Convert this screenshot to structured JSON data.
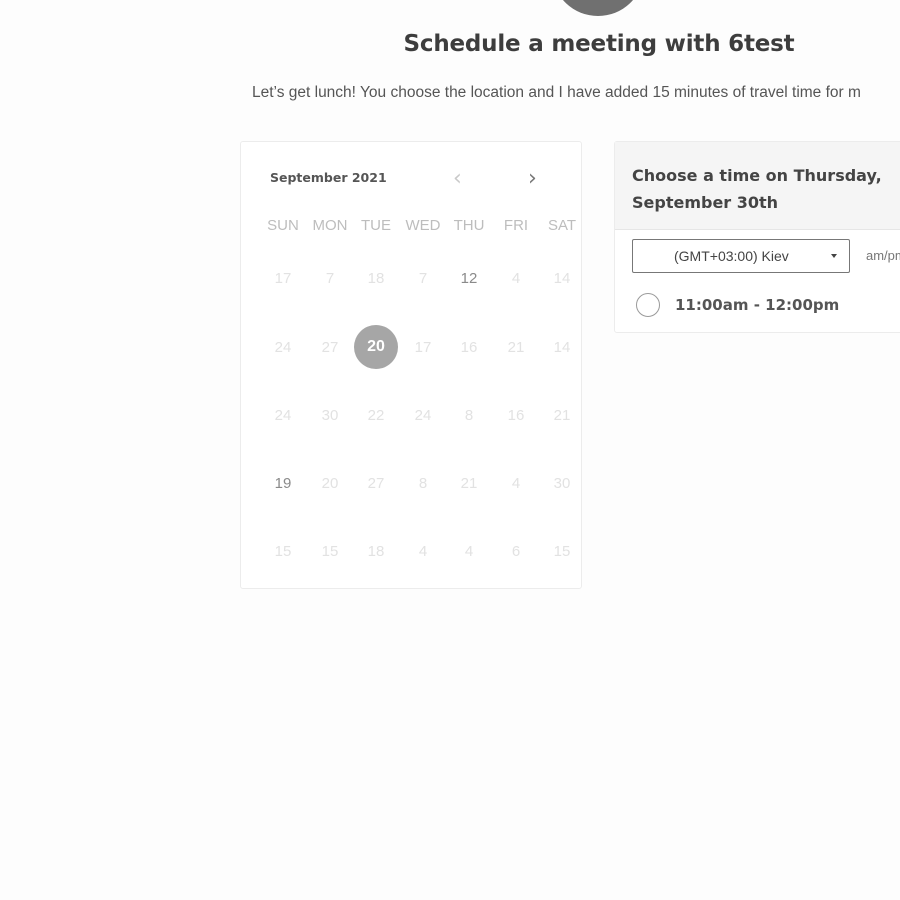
{
  "page": {
    "title": "Schedule a meeting with 6test",
    "description": "Let’s get lunch! You choose the location and I have added 15 minutes of travel time for m"
  },
  "calendar": {
    "month_label": "September 2021",
    "prev_symbol": "‹",
    "next_symbol": "›",
    "weekdays": [
      "SUN",
      "MON",
      "TUE",
      "WED",
      "THU",
      "FRI",
      "SAT"
    ],
    "weeks": [
      [
        "17",
        "7",
        "18",
        "7",
        "12",
        "4",
        "14"
      ],
      [
        "24",
        "27",
        "20",
        "17",
        "16",
        "21",
        "14"
      ],
      [
        "24",
        "30",
        "22",
        "24",
        "8",
        "16",
        "21"
      ],
      [
        "19",
        "20",
        "27",
        "8",
        "21",
        "4",
        "30"
      ],
      [
        "15",
        "15",
        "18",
        "4",
        "4",
        "6",
        "15"
      ]
    ],
    "selected_day": "20"
  },
  "time_panel": {
    "title": "Choose a time on Thursday, September 30th",
    "timezone": "(GMT+03:00) Kiev",
    "format_toggle": "am/pm",
    "slots": [
      "11:00am - 12:00pm"
    ]
  },
  "colors": {
    "selected_day_bg": "#a6a6a6",
    "avatar": "#707070"
  }
}
